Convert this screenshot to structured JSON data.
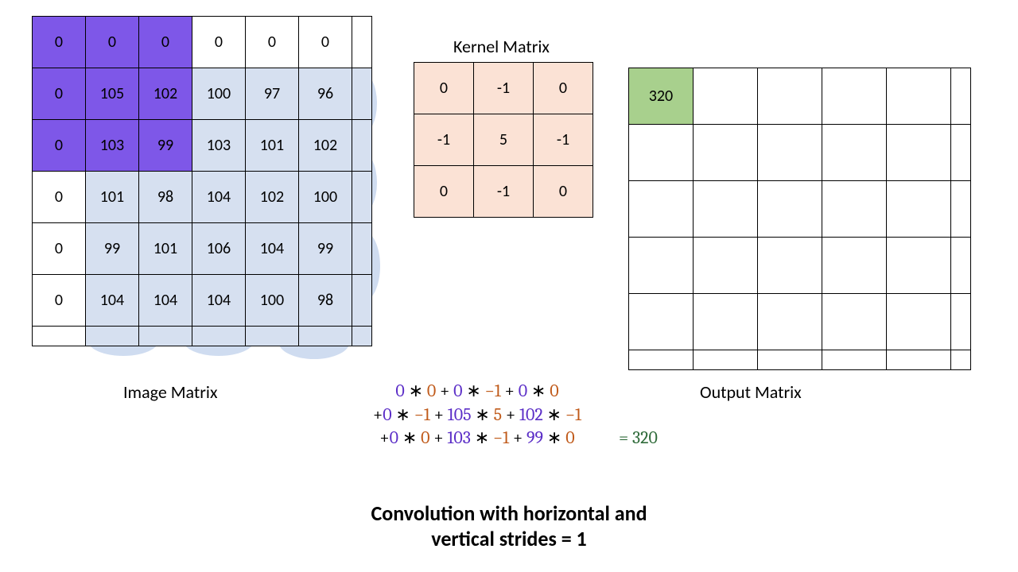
{
  "labels": {
    "image": "Image Matrix",
    "kernel": "Kernel Matrix",
    "output": "Output Matrix"
  },
  "title_line1": "Convolution with horizontal and",
  "title_line2": "vertical strides = 1",
  "image_matrix": {
    "rows": [
      [
        "0",
        "0",
        "0",
        "0",
        "0",
        "0"
      ],
      [
        "0",
        "105",
        "102",
        "100",
        "97",
        "96"
      ],
      [
        "0",
        "103",
        "99",
        "103",
        "101",
        "102"
      ],
      [
        "0",
        "101",
        "98",
        "104",
        "102",
        "100"
      ],
      [
        "0",
        "99",
        "101",
        "106",
        "104",
        "99"
      ],
      [
        "0",
        "104",
        "104",
        "104",
        "100",
        "98"
      ]
    ],
    "highlight_window": {
      "r0": 0,
      "c0": 0,
      "r1": 2,
      "c1": 2
    },
    "data_region": {
      "r0": 1,
      "c0": 1,
      "r1": 5,
      "c1": 5
    }
  },
  "kernel_matrix": {
    "rows": [
      [
        "0",
        "-1",
        "0"
      ],
      [
        "-1",
        "5",
        "-1"
      ],
      [
        "0",
        "-1",
        "0"
      ]
    ]
  },
  "output_matrix": {
    "rows": 5,
    "cols": 5,
    "values": {
      "0,0": "320"
    }
  },
  "equation": {
    "lines": [
      [
        {
          "t": "op",
          "v": ""
        },
        {
          "t": "img",
          "v": "0"
        },
        {
          "t": "op",
          "v": " ∗ "
        },
        {
          "t": "ker",
          "v": "0"
        },
        {
          "t": "op",
          "v": " + "
        },
        {
          "t": "img",
          "v": "0"
        },
        {
          "t": "op",
          "v": " ∗ "
        },
        {
          "t": "ker",
          "v": "−1"
        },
        {
          "t": "op",
          "v": " + "
        },
        {
          "t": "img",
          "v": "0"
        },
        {
          "t": "op",
          "v": " ∗ "
        },
        {
          "t": "ker",
          "v": "0"
        }
      ],
      [
        {
          "t": "op",
          "v": "+"
        },
        {
          "t": "img",
          "v": "0"
        },
        {
          "t": "op",
          "v": " ∗ "
        },
        {
          "t": "ker",
          "v": "−1"
        },
        {
          "t": "op",
          "v": " + "
        },
        {
          "t": "img",
          "v": "105"
        },
        {
          "t": "op",
          "v": " ∗ "
        },
        {
          "t": "ker",
          "v": "5"
        },
        {
          "t": "op",
          "v": " + "
        },
        {
          "t": "img",
          "v": "102"
        },
        {
          "t": "op",
          "v": " ∗ "
        },
        {
          "t": "ker",
          "v": "−1"
        }
      ],
      [
        {
          "t": "op",
          "v": "+"
        },
        {
          "t": "img",
          "v": "0"
        },
        {
          "t": "op",
          "v": " ∗ "
        },
        {
          "t": "ker",
          "v": "0"
        },
        {
          "t": "op",
          "v": " + "
        },
        {
          "t": "img",
          "v": "103"
        },
        {
          "t": "op",
          "v": " ∗ "
        },
        {
          "t": "ker",
          "v": "−1"
        },
        {
          "t": "op",
          "v": " + "
        },
        {
          "t": "img",
          "v": "99"
        },
        {
          "t": "op",
          "v": " ∗ "
        },
        {
          "t": "ker",
          "v": "0"
        }
      ]
    ],
    "result_prefix": "=  ",
    "result": "320"
  },
  "chart_data": {
    "type": "table",
    "description": "2D convolution step: 3x3 kernel applied at top-left window of padded image matrix, stride 1, producing first output cell 320.",
    "image_matrix": [
      [
        0,
        0,
        0,
        0,
        0,
        0
      ],
      [
        0,
        105,
        102,
        100,
        97,
        96
      ],
      [
        0,
        103,
        99,
        103,
        101,
        102
      ],
      [
        0,
        101,
        98,
        104,
        102,
        100
      ],
      [
        0,
        99,
        101,
        106,
        104,
        99
      ],
      [
        0,
        104,
        104,
        104,
        100,
        98
      ]
    ],
    "kernel": [
      [
        0,
        -1,
        0
      ],
      [
        -1,
        5,
        -1
      ],
      [
        0,
        -1,
        0
      ]
    ],
    "stride": 1,
    "current_window": {
      "row": 0,
      "col": 0,
      "size": 3
    },
    "output_known": [
      [
        320,
        null,
        null,
        null,
        null
      ],
      [
        null,
        null,
        null,
        null,
        null
      ],
      [
        null,
        null,
        null,
        null,
        null
      ],
      [
        null,
        null,
        null,
        null,
        null
      ],
      [
        null,
        null,
        null,
        null,
        null
      ]
    ],
    "computation": "0*0 + 0*-1 + 0*0 + 0*-1 + 105*5 + 102*-1 + 0*0 + 103*-1 + 99*0 = 320"
  }
}
